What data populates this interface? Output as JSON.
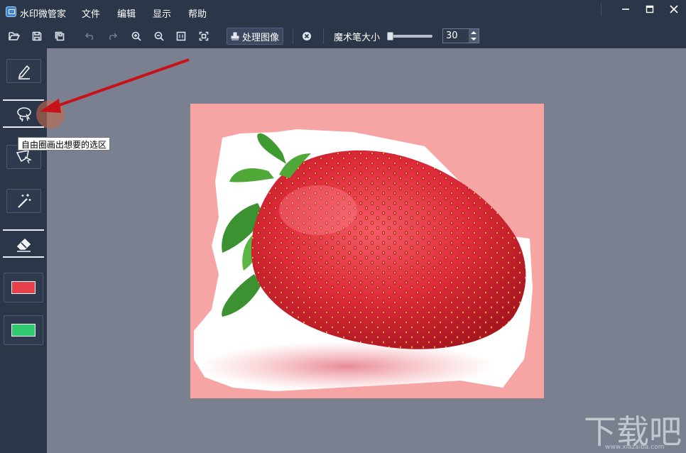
{
  "window": {
    "title": "水印微管家"
  },
  "menu": [
    "文件",
    "编辑",
    "显示",
    "帮助"
  ],
  "toolbar": {
    "process_label": "处理图像",
    "brush_size_label": "魔术笔大小",
    "brush_size_value": "30",
    "brush_slider_fraction": 0.0
  },
  "tools": {
    "tooltip": "自由圈画出想要的选区",
    "colors": {
      "mark": "#e8404a",
      "keep": "#2ecc6f"
    }
  },
  "watermark": {
    "url": "www.xiazaiba.com"
  }
}
